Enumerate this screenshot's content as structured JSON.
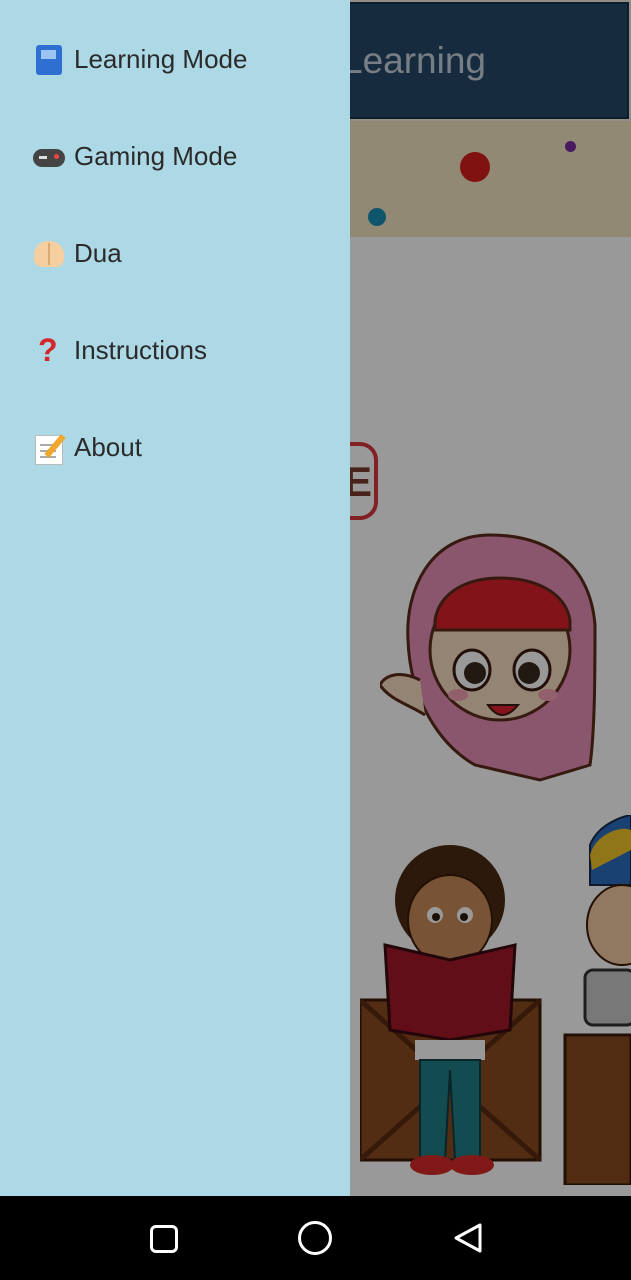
{
  "app": {
    "title": "Learning",
    "logo_letter": "E"
  },
  "drawer": {
    "items": [
      {
        "icon": "book-icon",
        "label": "Learning Mode"
      },
      {
        "icon": "game-controller-icon",
        "label": "Gaming Mode"
      },
      {
        "icon": "praying-hands-icon",
        "label": "Dua"
      },
      {
        "icon": "question-mark-icon",
        "label": "Instructions"
      },
      {
        "icon": "memo-icon",
        "label": "About"
      }
    ]
  },
  "navbar": {
    "buttons": [
      "recents",
      "home",
      "back"
    ]
  },
  "colors": {
    "drawer_bg": "#add8e6",
    "app_bar": "#254866",
    "banner": "#f3e4c2"
  }
}
